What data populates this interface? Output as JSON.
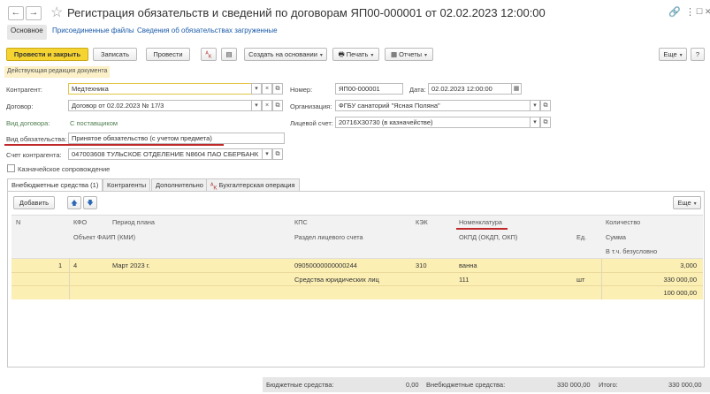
{
  "window": {
    "title": "Регистрация обязательств и сведений по договорам ЯП00-000001 от 02.02.2023 12:00:00",
    "back_glyph": "←",
    "forward_glyph": "→",
    "link_glyph": "🔗",
    "more_glyph": "⋮",
    "max_glyph": "☐",
    "close_glyph": "✕"
  },
  "tabs": [
    {
      "label": "Основное"
    },
    {
      "label": "Присоединенные файлы"
    },
    {
      "label": "Сведения об обязательствах загруженные"
    }
  ],
  "toolbar": {
    "post_close": "Провести и закрыть",
    "write": "Записать",
    "post": "Провести",
    "create_based": "Создать на основании",
    "print": "Печать",
    "reports": "Отчеты",
    "more": "Еще"
  },
  "notice": "Действующая редакция документа",
  "form": {
    "counterparty_label": "Контрагент:",
    "counterparty_value": "Медтехника",
    "number_label": "Номер:",
    "number_value": "ЯП00-000001",
    "date_label": "Дата:",
    "date_value": "02.02.2023 12:00:00",
    "contract_label": "Договор:",
    "contract_value": "Договор от 02.02.2023 № 17/3",
    "org_label": "Организация:",
    "org_value": "ФГБУ санаторий \"Ясная Поляна\"",
    "contract_type_label": "Вид договора:",
    "contract_type_value": "С поставщиком",
    "account_label": "Лицевой счет:",
    "account_value": "20716Х30730 (в казначействе)",
    "obligation_type_label": "Вид обязательства:",
    "obligation_type_value": "Принятое обязательство (с учетом предмета)",
    "counter_account_label": "Счет контрагента:",
    "counter_account_value": "047003608 ТУЛЬСКОЕ ОТДЕЛЕНИЕ N8604 ПАО СБЕРБАНК",
    "treasury_label": "Казначейское сопровождение"
  },
  "inner_tabs": [
    {
      "label": "Внебюджетные средства (1)"
    },
    {
      "label": "Контрагенты"
    },
    {
      "label": "Дополнительно"
    },
    {
      "label": "Бухгалтерская операция"
    }
  ],
  "grid_toolbar": {
    "add": "Добавить",
    "more": "Еще"
  },
  "grid": {
    "headers_row1": [
      "N",
      "КФО",
      "Период плана",
      "КПС",
      "КЭК",
      "Номенклатура",
      "Количество"
    ],
    "headers_row2": [
      "Объект ФАИП (КМИ)",
      "Раздел лицевого счета",
      "ОКПД (ОКДП, ОКП)",
      "Ед.",
      "Сумма"
    ],
    "headers_row3": [
      "В т.ч. безусловно"
    ],
    "row": {
      "n": "1",
      "kfo": "4",
      "period": "Март 2023 г.",
      "kps": "09050000000000244",
      "kek": "310",
      "nomenclature": "ванна",
      "quantity": "3,000",
      "section": "Средства юридических лиц",
      "okpd": "111",
      "unit": "шт",
      "sum": "330 000,00",
      "unconditional": "100 000,00"
    }
  },
  "footer": {
    "budget_label": "Бюджетные средства:",
    "budget_value": "0,00",
    "extra_label": "Внебюджетные средства:",
    "extra_value": "330 000,00",
    "total_label": "Итого:",
    "total_value": "330 000,00"
  },
  "colors": {
    "primary_button": "#f5d431",
    "selected_row": "#fcefb4",
    "underline": "#c0282a",
    "link": "#1a5aa8"
  }
}
